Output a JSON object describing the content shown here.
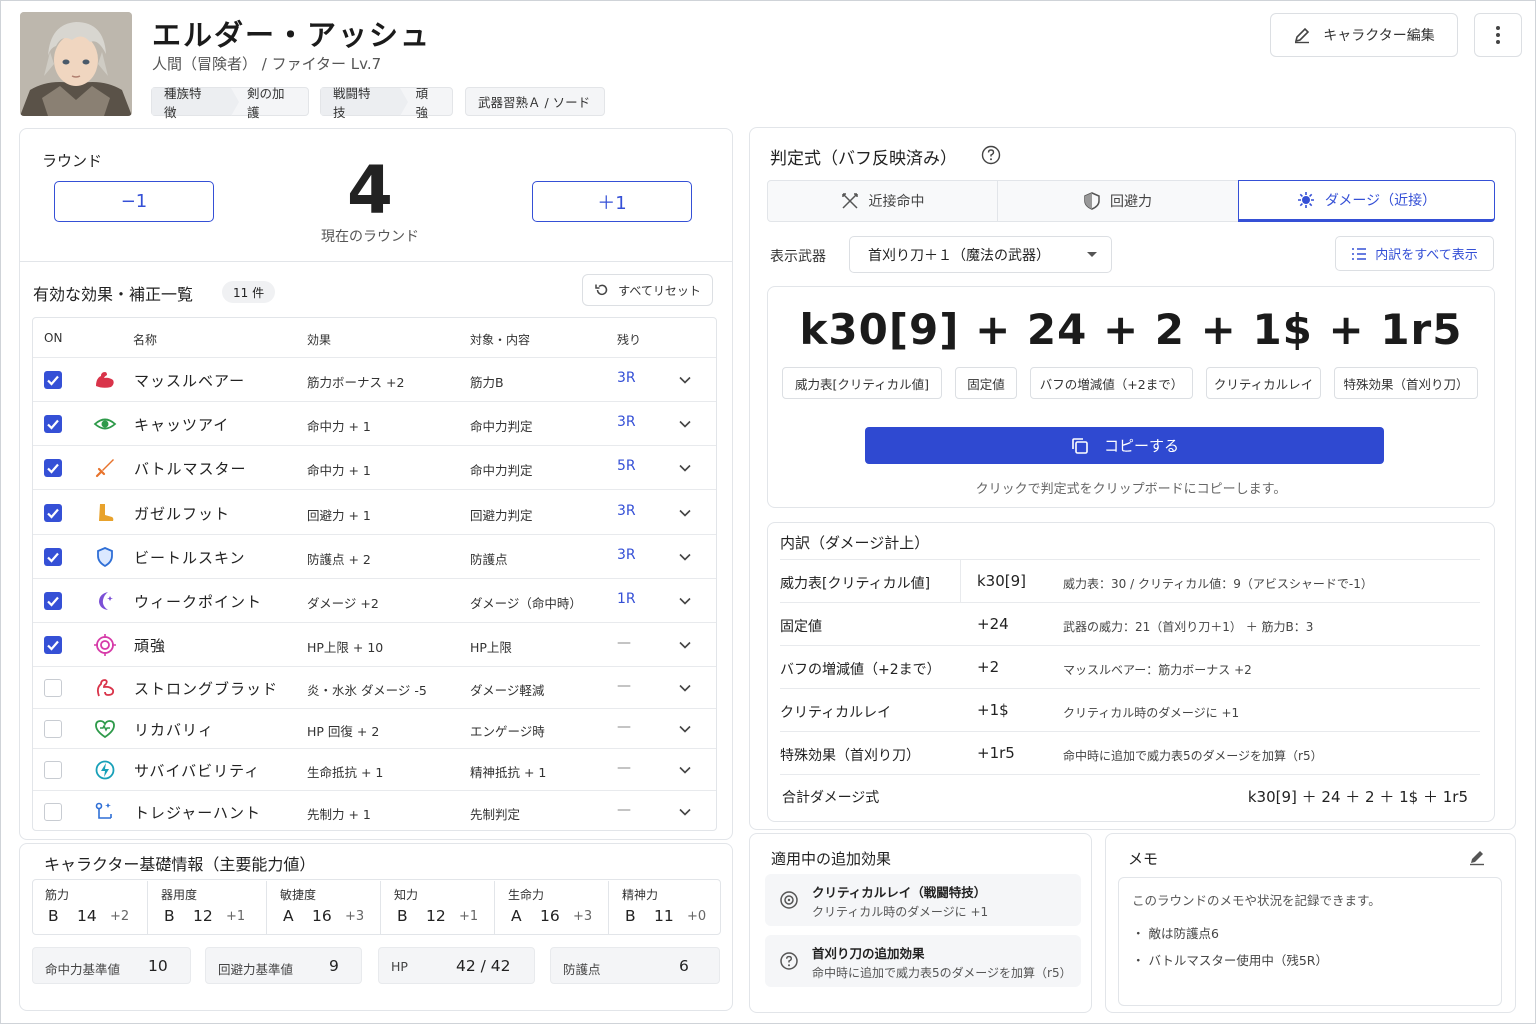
{
  "character": {
    "name": "エルダー・アッシュ",
    "subtitle": "人間（冒険者） / ファイター Lv.7",
    "tags": [
      {
        "key": "種族特徴",
        "value": "剣の加護"
      },
      {
        "key": "戦闘特技",
        "value": "頑強"
      },
      {
        "key": "",
        "value": "武器習熟Ａ / ソード"
      }
    ]
  },
  "header": {
    "edit_label": "キャラクター編集"
  },
  "round": {
    "label": "ラウンド",
    "minus_label": "−1",
    "plus_label": "＋1",
    "value": "4",
    "caption": "現在のラウンド"
  },
  "effects": {
    "title": "有効な効果・補正一覧",
    "count": "11 件",
    "reset_label": "すべてリセット",
    "columns": [
      "ON",
      "名称",
      "効果",
      "対象・内容",
      "残り"
    ],
    "rows": [
      {
        "on": true,
        "icon": "muscle-icon",
        "name": "マッスルベアー",
        "effect": "筋力ボーナス +2",
        "target": "筋力B",
        "remain": "3R"
      },
      {
        "on": true,
        "icon": "eye-icon",
        "name": "キャッツアイ",
        "effect": "命中力 + 1",
        "target": "命中力判定",
        "remain": "3R"
      },
      {
        "on": true,
        "icon": "sword-icon",
        "name": "バトルマスター",
        "effect": "命中力 + 1",
        "target": "命中力判定",
        "remain": "5R"
      },
      {
        "on": true,
        "icon": "boot-icon",
        "name": "ガゼルフット",
        "effect": "回避力 + 1",
        "target": "回避力判定",
        "remain": "3R"
      },
      {
        "on": true,
        "icon": "shield-icon",
        "name": "ビートルスキン",
        "effect": "防護点 + 2",
        "target": "防護点",
        "remain": "3R"
      },
      {
        "on": true,
        "icon": "moon-icon",
        "name": "ウィークポイント",
        "effect": "ダメージ +2",
        "target": "ダメージ（命中時）",
        "remain": "1R"
      },
      {
        "on": true,
        "icon": "target-icon",
        "name": "頑強",
        "effect": "HP上限 + 10",
        "target": "HP上限",
        "remain": "—"
      },
      {
        "on": false,
        "icon": "arm-icon",
        "name": "ストロングブラッド",
        "effect": "炎・水氷 ダメージ -5",
        "target": "ダメージ軽減",
        "remain": "—"
      },
      {
        "on": false,
        "icon": "heart-icon",
        "name": "リカバリィ",
        "effect": "HP 回復 + 2",
        "target": "エンゲージ時",
        "remain": "—"
      },
      {
        "on": false,
        "icon": "shield-bolt-icon",
        "name": "サバイバビリティ",
        "effect": "生命抵抗 + 1",
        "target": "精神抵抗 + 1",
        "remain": "—"
      },
      {
        "on": false,
        "icon": "route-icon",
        "name": "トレジャーハント",
        "effect": "先制力 + 1",
        "target": "先制判定",
        "remain": "—"
      }
    ]
  },
  "basic": {
    "title": "キャラクター基礎情報（主要能力値）",
    "stats": [
      {
        "label": "筋力",
        "grade": "B",
        "value": "14",
        "mod": "+2"
      },
      {
        "label": "器用度",
        "grade": "B",
        "value": "12",
        "mod": "+1"
      },
      {
        "label": "敏捷度",
        "grade": "A",
        "value": "16",
        "mod": "+3"
      },
      {
        "label": "知力",
        "grade": "B",
        "value": "12",
        "mod": "+1"
      },
      {
        "label": "生命力",
        "grade": "A",
        "value": "16",
        "mod": "+3"
      },
      {
        "label": "精神力",
        "grade": "B",
        "value": "11",
        "mod": "+0"
      }
    ],
    "bases": [
      {
        "label": "命中力基準値",
        "value": "10"
      },
      {
        "label": "回避力基準値",
        "value": "9"
      },
      {
        "label": "HP",
        "value": "42 / 42"
      },
      {
        "label": "防護点",
        "value": "6"
      }
    ]
  },
  "formula_panel": {
    "title": "判定式（バフ反映済み）",
    "tabs": [
      "近接命中",
      "回避力",
      "ダメージ（近接）"
    ],
    "weapon_label": "表示武器",
    "weapon_value": "首刈り刀＋１（魔法の武器）",
    "detail_label": "内訳をすべて表示",
    "formula": "k30[9] + 24 + 2 + 1$ + 1r5",
    "parts": [
      "威力表[クリティカル値]",
      "固定値",
      "バフの増減値（+2まで）",
      "クリティカルレイ",
      "特殊効果（首刈り刀）"
    ],
    "copy_label": "コピーする",
    "hint": "クリックで判定式をクリップボードにコピーします。"
  },
  "breakdown": {
    "title": "内訳（ダメージ計上）",
    "rows": [
      {
        "name": "威力表[クリティカル値]",
        "value": "k30[9]",
        "detail": "威力表：30 / クリティカル値：9（アビスシャードで-1）"
      },
      {
        "name": "固定値",
        "value": "+24",
        "detail": "武器の威力：21（首刈り刀＋1） ＋ 筋力B：3"
      },
      {
        "name": "バフの増減値（+2まで）",
        "value": "+2",
        "detail": "マッスルベアー：筋力ボーナス +2"
      },
      {
        "name": "クリティカルレイ",
        "value": "+1$",
        "detail": "クリティカル時のダメージに +1"
      },
      {
        "name": "特殊効果（首刈り刀）",
        "value": "+1r5",
        "detail": "命中時に追加で威力表5のダメージを加算（r5）"
      }
    ],
    "total_label": "合計ダメージ式",
    "total_value": "k30[9] ＋ 24 ＋ 2 ＋ 1$ ＋ 1r5"
  },
  "extra": {
    "title": "適用中の追加効果",
    "items": [
      {
        "title": "クリティカルレイ（戦闘特技）",
        "desc": "クリティカル時のダメージに +1"
      },
      {
        "title": "首刈り刀の追加効果",
        "desc": "命中時に追加で威力表5のダメージを加算（r5）"
      }
    ]
  },
  "memo": {
    "title": "メモ",
    "placeholder": "このラウンドのメモや状況を記録できます。",
    "items": [
      "・ 敵は防護点6",
      "・ バトルマスター使用中（残5R）"
    ]
  },
  "colors": {
    "accent": "#3550d6",
    "primary_button": "#2f49d1"
  }
}
